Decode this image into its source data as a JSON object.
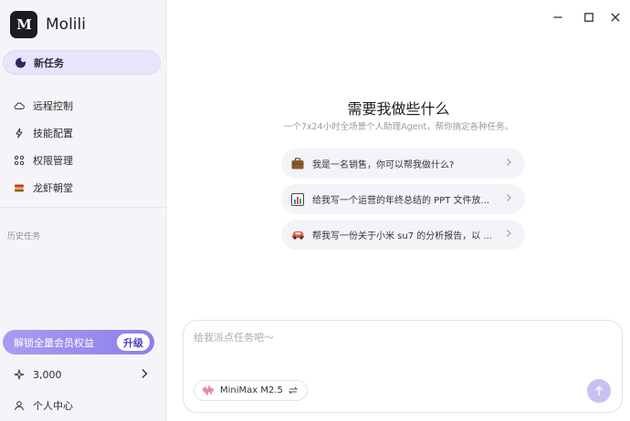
{
  "app": {
    "name": "Molili",
    "logo_text": "M"
  },
  "sidebar": {
    "new_task_label": "新任务",
    "items": [
      {
        "label": "远程控制",
        "icon": "cloud-icon"
      },
      {
        "label": "技能配置",
        "icon": "lightning-icon"
      },
      {
        "label": "权限管理",
        "icon": "grid-icon"
      },
      {
        "label": "龙虾朝堂",
        "icon": "lobster-icon"
      }
    ],
    "history_label": "历史任务",
    "upgrade": {
      "label": "解锁全量会员权益",
      "button": "升级"
    },
    "credits": "3,000",
    "profile_label": "个人中心"
  },
  "main": {
    "heading": "需要我做些什么",
    "subheading": "一个7x24小时全场景个人助理Agent，帮你搞定各种任务。",
    "suggestions": [
      {
        "icon": "briefcase-icon",
        "text": "我是一名销售，你可以帮我做什么?"
      },
      {
        "icon": "chart-icon",
        "text": "给我写一个运营的年终总结的 PPT 文件放..."
      },
      {
        "icon": "car-icon",
        "text": "帮我写一份关于小米 su7 的分析报告，以 ..."
      }
    ]
  },
  "composer": {
    "placeholder": "给我派点任务吧～",
    "model": "MiniMax M2.5"
  },
  "colors": {
    "accent": "#8d80ea",
    "accent_light": "#e7e5fb",
    "sidebar_bg": "#f5f5f9"
  }
}
